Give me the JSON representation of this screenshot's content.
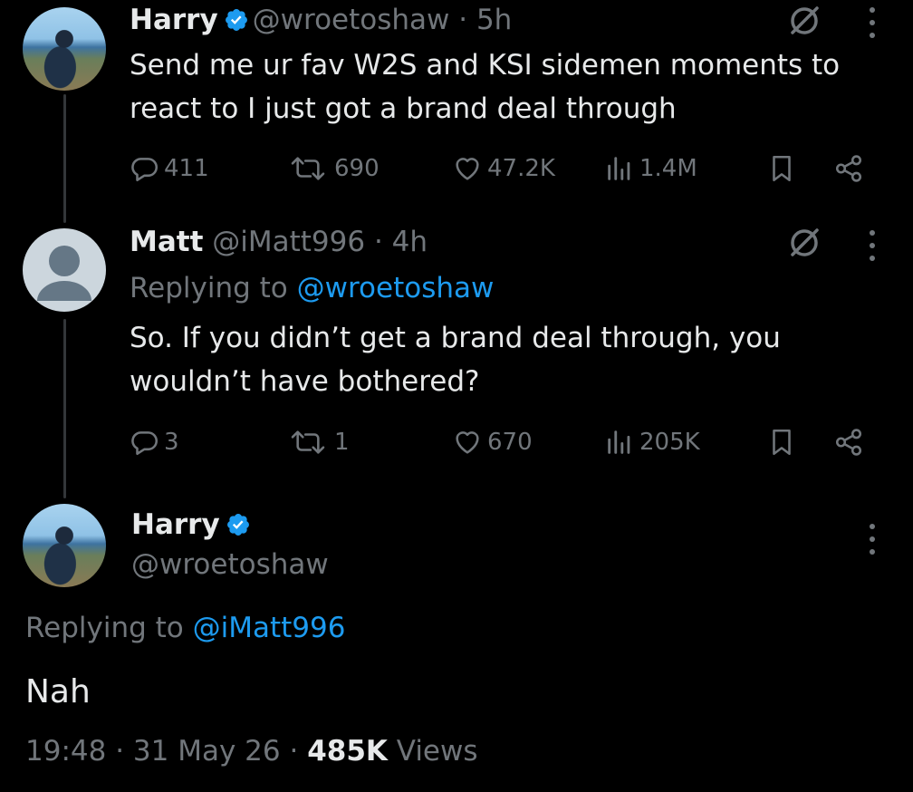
{
  "tweet1": {
    "name": "Harry",
    "handle": "@wroetoshaw",
    "time": "· 5h",
    "text_line1": "Send me ur fav W2S and KSI sidemen moments to",
    "text_line2": "react to I just got a brand deal through",
    "replies": "411",
    "reposts": "690",
    "likes": "47.2K",
    "views": "1.4M"
  },
  "tweet2": {
    "name": "Matt",
    "handle": "@iMatt996",
    "time": "· 4h",
    "replying_prefix": "Replying to",
    "replying_handle": "@wroetoshaw",
    "text_line1": "So. If you didn’t get a brand deal through, you",
    "text_line2": "wouldn’t have bothered?",
    "replies": "3",
    "reposts": "1",
    "likes": "670",
    "views": "205K"
  },
  "main_tweet": {
    "name": "Harry",
    "handle": "@wroetoshaw",
    "replying_prefix": "Replying to",
    "replying_handle": "@iMatt996",
    "text": "Nah",
    "time": "19:48",
    "date": "31 May 26",
    "views_count": "485K",
    "views_label": "Views"
  },
  "colors": {
    "background": "#000000",
    "text": "#e7e9ea",
    "muted": "#71767b",
    "accent": "#1d9bf0",
    "thread_line": "#333639"
  }
}
